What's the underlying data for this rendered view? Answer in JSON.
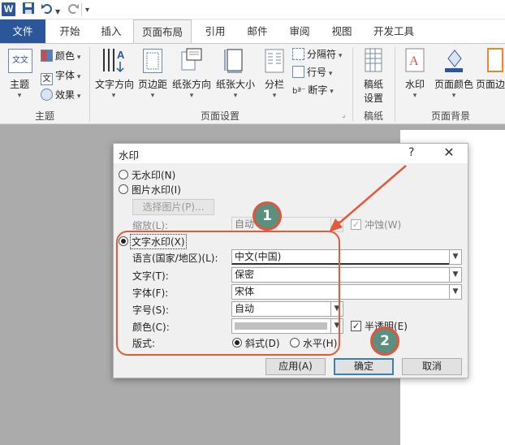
{
  "app": {
    "logo_letter": "W",
    "quick_access": [
      "save-icon",
      "undo-icon",
      "redo-icon",
      "customize-icon"
    ]
  },
  "tabs": [
    {
      "label": "文件"
    },
    {
      "label": "开始"
    },
    {
      "label": "插入"
    },
    {
      "label": "页面布局",
      "active": true
    },
    {
      "label": "引用"
    },
    {
      "label": "邮件"
    },
    {
      "label": "审阅"
    },
    {
      "label": "视图"
    },
    {
      "label": "开发工具"
    }
  ],
  "ribbon": {
    "theme_group": {
      "label": "主题",
      "theme_button": "主题",
      "colors": "颜色",
      "fonts": "字体",
      "effects": "效果",
      "theme_icon_text": "文文",
      "fonts_icon_text": "文"
    },
    "page_setup_group": {
      "label": "页面设置",
      "text_direction": "文字方向",
      "margins": "页边距",
      "orientation": "纸张方向",
      "size": "纸张大小",
      "columns": "分栏",
      "breaks": "分隔符",
      "line_numbers": "行号",
      "hyphenation": "断字",
      "text_direction_icon_text": "A"
    },
    "draft_group": {
      "label": "稿纸",
      "draft_settings_line1": "稿纸",
      "draft_settings_line2": "设置"
    },
    "background_group": {
      "label": "页面背景",
      "watermark": "水印",
      "page_color": "页面颜色",
      "page_borders": "页面边",
      "watermark_icon_text": "A"
    }
  },
  "dialog": {
    "title": "水印",
    "help": "?",
    "close": "✕",
    "no_watermark": "无水印(N)",
    "picture_watermark": "图片水印(I)",
    "select_picture": "选择图片(P)...",
    "scale_label": "缩放(L):",
    "scale_value": "自动",
    "washout": "冲蚀(W)",
    "text_watermark": "文字水印(X)",
    "language_label": "语言(国家/地区)(L):",
    "language_value": "中文(中国)",
    "text_label": "文字(T):",
    "text_value": "保密",
    "font_label": "字体(F):",
    "font_value": "宋体",
    "size_label": "字号(S):",
    "size_value": "自动",
    "color_label": "颜色(C):",
    "semitransparent": "半透明(E)",
    "layout_label": "版式:",
    "diagonal": "斜式(D)",
    "horizontal": "水平(H)",
    "apply": "应用(A)",
    "ok": "确定",
    "cancel": "取消",
    "selected_type": "text",
    "selected_layout": "diagonal",
    "semitransparent_checked": true,
    "washout_checked": true
  },
  "annotations": {
    "marker1": "1",
    "marker2": "2",
    "color": "#e35a3a",
    "marker_fill": "#5b8f7e"
  }
}
